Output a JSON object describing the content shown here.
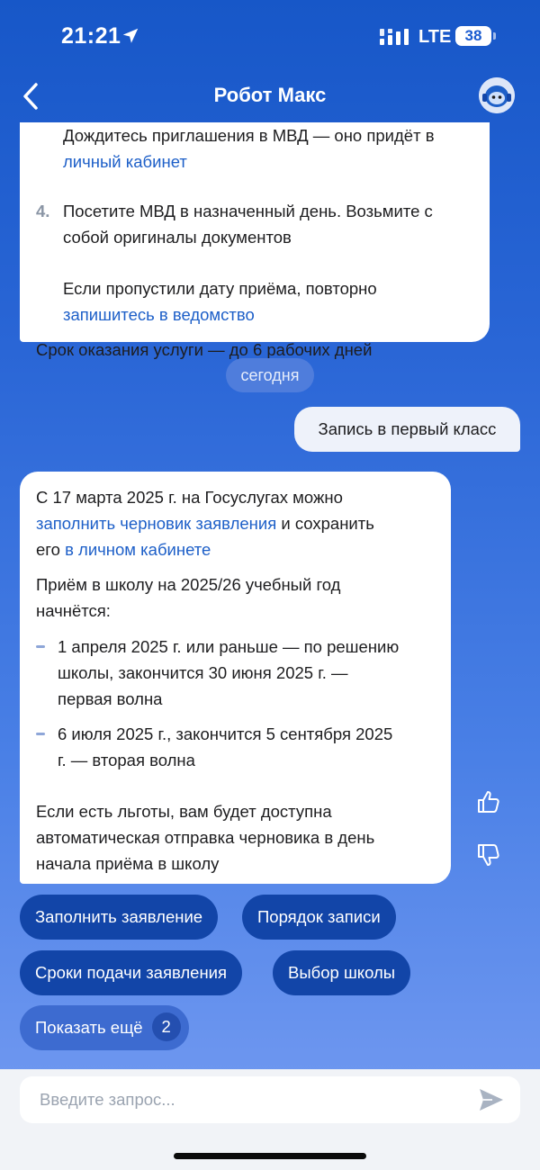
{
  "status_bar": {
    "time": "21:21",
    "network": "LTE",
    "battery": "38"
  },
  "header": {
    "title": "Робот Макс"
  },
  "messages": {
    "previous": {
      "step3_cut_line1": "Дождитесь приглашения в МВД — оно придёт в",
      "step3_link": "личный кабинет",
      "step4_number": "4.",
      "step4_line1": "Посетите МВД в назначенный день. Возьмите с",
      "step4_line2": "собой оригиналы документов",
      "missed_text": "Если пропустили дату приёма, повторно",
      "missed_link": "запишитесь в ведомство",
      "deadline": "Срок оказания услуги — до 6 рабочих дней"
    },
    "date_separator": "сегодня",
    "user_message": "Запись в первый класс",
    "bot_reply": {
      "p1_line1": "С 17 марта 2025 г. на Госуслугах можно",
      "p1_link1": "заполнить черновик заявления",
      "p1_text2": " и сохранить",
      "p1_text3": "его ",
      "p1_link2": "в личном кабинете",
      "p2_line1": "Приём в школу на 2025/26 учебный год",
      "p2_line2": "начнётся:",
      "b1_line1": "1 апреля 2025 г. или раньше — по решению",
      "b1_line2": "школы, закончится 30 июня 2025 г. —",
      "b1_line3": "первая волна",
      "b2_line1": "6 июля 2025 г., закончится 5 сентября 2025",
      "b2_line2": "г. — вторая волна",
      "p3_line1": "Если есть льготы, вам будет доступна",
      "p3_line2": "автоматическая отправка черновика в день",
      "p3_line3": "начала приёма в школу"
    }
  },
  "quick_replies": {
    "fill_application": "Заполнить заявление",
    "enrollment_order": "Порядок записи",
    "submission_deadlines": "Сроки подачи заявления",
    "school_choice": "Выбор школы",
    "show_more": "Показать ещё",
    "show_more_count": "2"
  },
  "input": {
    "placeholder": "Введите запрос..."
  },
  "icons": {
    "location": "location-arrow-icon",
    "signal": "signal-bars-icon",
    "back": "chevron-left-icon",
    "avatar": "robot-avatar-icon",
    "like": "thumbs-up-icon",
    "dislike": "thumbs-down-icon",
    "send": "send-icon"
  },
  "colors": {
    "accent": "#1245a8",
    "link": "#1d5fc8",
    "background_top": "#1757c8",
    "background_bottom": "#6e98f0"
  }
}
